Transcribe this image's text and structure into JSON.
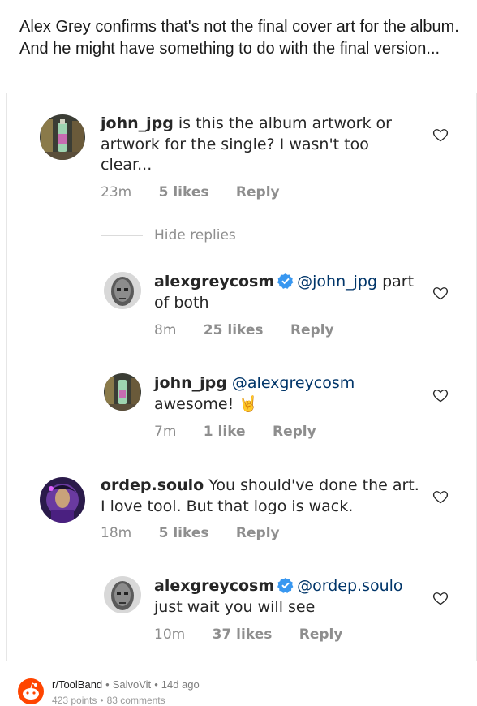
{
  "post": {
    "title": "Alex Grey confirms that's not the final cover art for the album. And he might have something to do with the final version..."
  },
  "comments": [
    {
      "user": "john_jpg",
      "text": "is this the album artwork or artwork for the single? I wasn't too clear...",
      "time": "23m",
      "likes": "5 likes",
      "reply": "Reply"
    },
    {
      "user": "alexgreycosm",
      "mention": "@john_jpg",
      "text": "part of both",
      "time": "8m",
      "likes": "25 likes",
      "reply": "Reply"
    },
    {
      "user": "john_jpg",
      "mention": "@alexgreycosm",
      "text": "awesome!",
      "emoji": "🤘",
      "time": "7m",
      "likes": "1 like",
      "reply": "Reply"
    },
    {
      "user": "ordep.soulo",
      "text": "You should've done the art. I love tool. But that logo is wack.",
      "time": "18m",
      "likes": "5 likes",
      "reply": "Reply"
    },
    {
      "user": "alexgreycosm",
      "mention": "@ordep.soulo",
      "text": "just wait you will see",
      "time": "10m",
      "likes": "37 likes",
      "reply": "Reply"
    }
  ],
  "hide_replies": "Hide replies",
  "footer": {
    "subreddit": "r/ToolBand",
    "author": "SalvoVit",
    "age": "14d ago",
    "points": "423 points",
    "comments": "83 comments"
  },
  "colors": {
    "username": "#262626",
    "mention": "#003569",
    "meta": "#8e8e8e",
    "verified": "#3897f0",
    "reddit": "#ff4500"
  },
  "icons": [
    "heart-icon",
    "verified-badge-icon",
    "reddit-snoo-icon"
  ]
}
